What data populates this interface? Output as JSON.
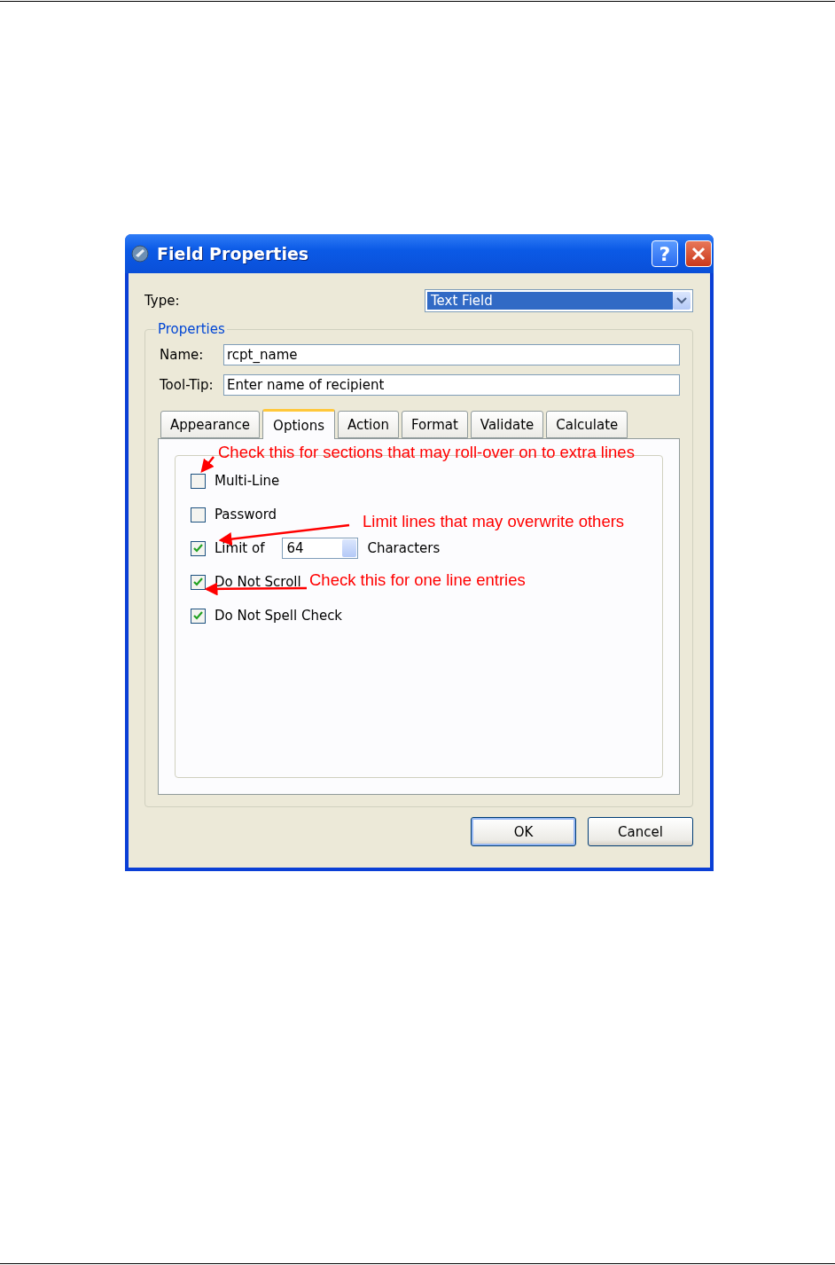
{
  "window": {
    "title": "Field Properties",
    "help": "?"
  },
  "type": {
    "label": "Type:",
    "value": "Text Field"
  },
  "properties": {
    "legend": "Properties",
    "name": {
      "label": "Name:",
      "value": "rcpt_name"
    },
    "tooltip": {
      "label": "Tool-Tip:",
      "value": "Enter name of recipient"
    }
  },
  "tabs": [
    {
      "label": "Appearance",
      "selected": false
    },
    {
      "label": "Options",
      "selected": true
    },
    {
      "label": "Action",
      "selected": false
    },
    {
      "label": "Format",
      "selected": false
    },
    {
      "label": "Validate",
      "selected": false
    },
    {
      "label": "Calculate",
      "selected": false
    }
  ],
  "options": [
    {
      "kind": "checkbox",
      "label": "Multi-Line",
      "checked": false
    },
    {
      "kind": "checkbox",
      "label": "Password",
      "checked": false
    },
    {
      "kind": "limit",
      "label": "Limit of",
      "checked": true,
      "value": "64",
      "suffix": "Characters"
    },
    {
      "kind": "checkbox",
      "label": "Do Not Scroll",
      "checked": true
    },
    {
      "kind": "checkbox",
      "label": "Do Not Spell Check",
      "checked": true
    }
  ],
  "annotations": [
    {
      "text": "Check this for sections that may roll-over on to extra lines"
    },
    {
      "text": "Limit lines that may overwrite others"
    },
    {
      "text": "Check this for one line entries"
    }
  ],
  "buttons": [
    {
      "label": "OK",
      "default": true
    },
    {
      "label": "Cancel",
      "default": false
    }
  ]
}
